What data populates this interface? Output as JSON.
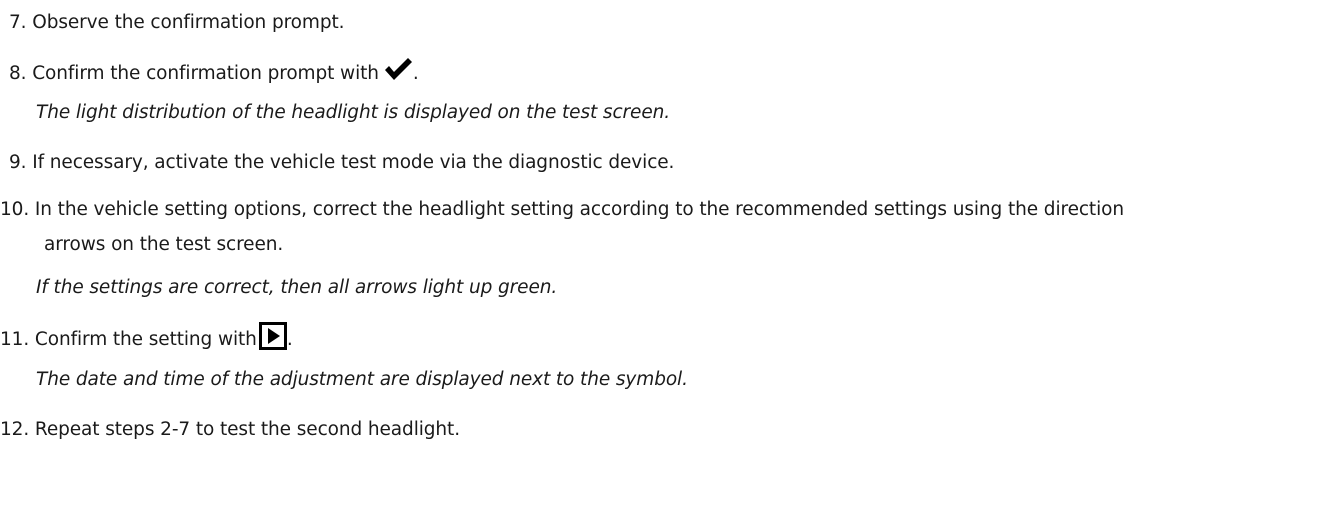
{
  "steps": [
    {
      "number": "7.",
      "text": "Observe the confirmation prompt."
    },
    {
      "number": "8.",
      "text": "Confirm the confirmation prompt with",
      "suffix": ".",
      "icon": "checkmark-icon",
      "result": "The light distribution of the headlight is displayed on the test screen."
    },
    {
      "number": "9.",
      "text": "If necessary, activate the vehicle test mode via the diagnostic device."
    },
    {
      "number": "10.",
      "text": "In the vehicle setting options, correct the headlight setting according to the recommended settings using the direction",
      "text_cont": "arrows on the test screen.",
      "result": "If the settings are correct, then all arrows light up green."
    },
    {
      "number": "11.",
      "text": "Confirm the setting with",
      "suffix": ".",
      "icon": "play-button-icon",
      "result": "The date and time of the adjustment are displayed next to the symbol."
    },
    {
      "number": "12.",
      "text": "Repeat steps 2-7 to test the second headlight."
    }
  ]
}
